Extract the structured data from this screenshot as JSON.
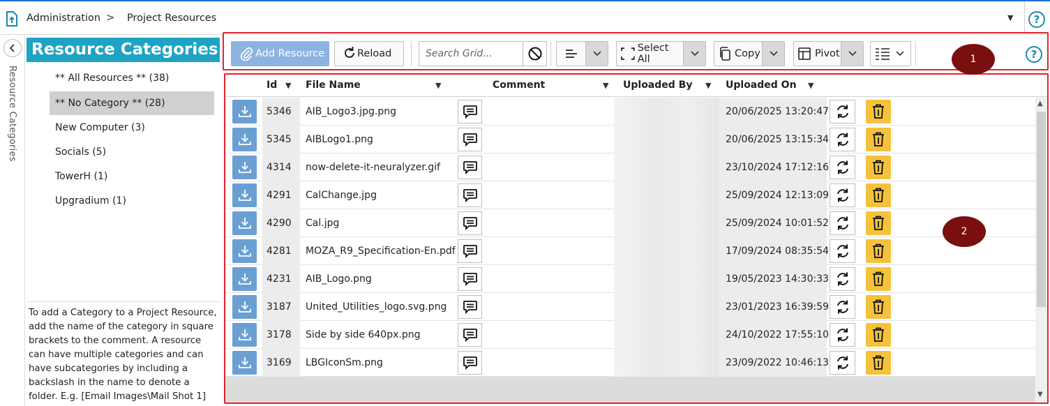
{
  "header": {
    "breadcrumb": [
      "Administration",
      "Project Resources"
    ],
    "separator": ">"
  },
  "sidebar": {
    "vertical_label": "Resource Categories",
    "title": "Resource Categories",
    "categories": [
      {
        "label": "** All Resources ** (38)",
        "selected": false
      },
      {
        "label": "** No Category ** (28)",
        "selected": true
      },
      {
        "label": "New Computer (3)",
        "selected": false
      },
      {
        "label": "Socials (5)",
        "selected": false
      },
      {
        "label": "TowerH (1)",
        "selected": false
      },
      {
        "label": "Upgradium (1)",
        "selected": false
      }
    ],
    "note": "To add a Category to a Project Resource, add the name of the category in square brackets to the comment. A resource can have multiple categories and can have subcategories by including a backslash in the name to denote a folder.  E.g. [Email Images\\Mail Shot 1]"
  },
  "toolbar": {
    "add_resource": "Add Resource",
    "reload": "Reload",
    "search_placeholder": "Search Grid...",
    "select_all": "Select All",
    "copy": "Copy",
    "pivot": "Pivot"
  },
  "markers": [
    "1",
    "2"
  ],
  "grid": {
    "columns": [
      "Id",
      "File Name",
      "Comment",
      "Uploaded By",
      "Uploaded On"
    ],
    "rows": [
      {
        "id": "5346",
        "file": "AIB_Logo3.jpg.png",
        "uploaded_on": "20/06/2025 13:20:47"
      },
      {
        "id": "5345",
        "file": "AIBLogo1.png",
        "uploaded_on": "20/06/2025 13:15:34"
      },
      {
        "id": "4314",
        "file": "now-delete-it-neuralyzer.gif",
        "uploaded_on": "23/10/2024 17:12:16"
      },
      {
        "id": "4291",
        "file": "CalChange.jpg",
        "uploaded_on": "25/09/2024 12:13:09"
      },
      {
        "id": "4290",
        "file": "Cal.jpg",
        "uploaded_on": "25/09/2024 10:01:52"
      },
      {
        "id": "4281",
        "file": "MOZA_R9_Specification-En.pdf",
        "uploaded_on": "17/09/2024 08:35:54"
      },
      {
        "id": "4231",
        "file": "AIB_Logo.png",
        "uploaded_on": "19/05/2023 14:30:33"
      },
      {
        "id": "3187",
        "file": "United_Utilities_logo.svg.png",
        "uploaded_on": "23/01/2023 16:39:59"
      },
      {
        "id": "3178",
        "file": "Side by side 640px.png",
        "uploaded_on": "24/10/2022 17:55:10"
      },
      {
        "id": "3169",
        "file": "LBGIconSm.png",
        "uploaded_on": "23/09/2022 10:46:13"
      }
    ]
  },
  "colors": {
    "accent_blue": "#1ea3c4",
    "add_button": "#8db3e0",
    "download_button": "#6a9fd4",
    "delete_button": "#f5c23b",
    "annotation_box": "#e0242c",
    "marker": "#7a0f0f"
  }
}
